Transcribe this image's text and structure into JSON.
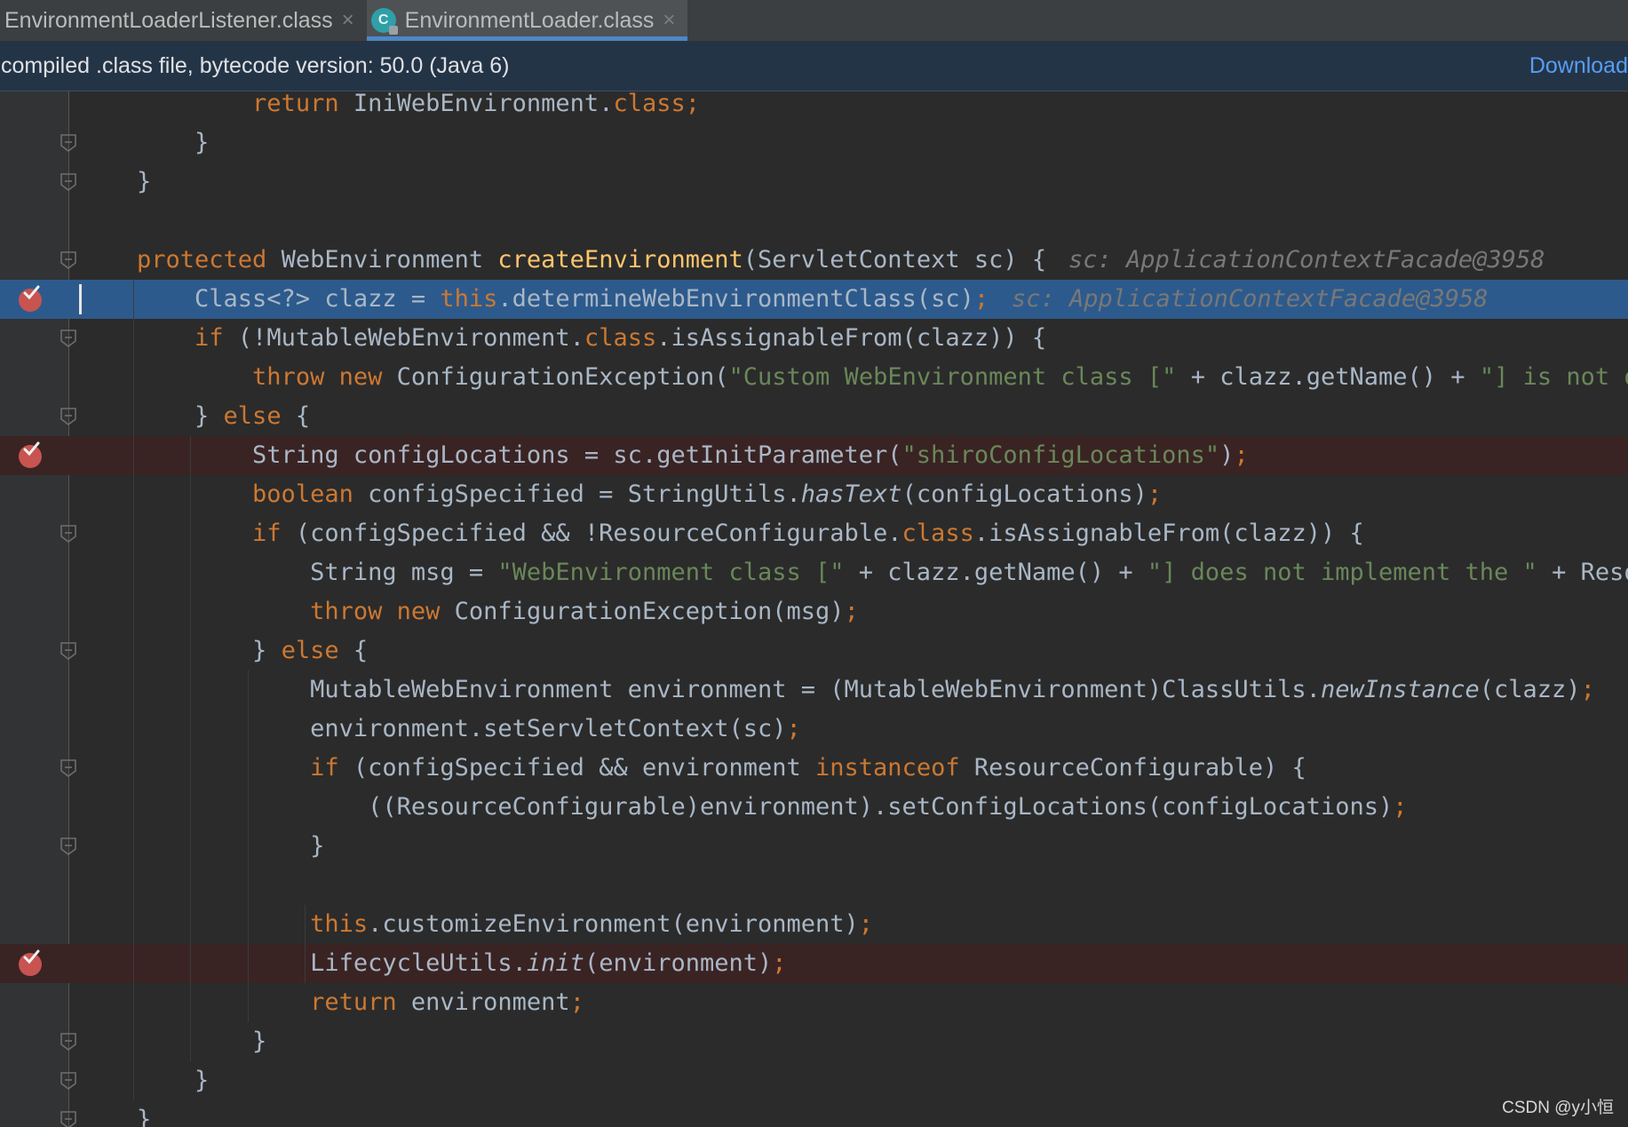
{
  "tabs": [
    {
      "label": "EnvironmentLoaderListener.class",
      "active": false
    },
    {
      "label": "EnvironmentLoader.class",
      "active": true
    }
  ],
  "tab_close_glyph": "×",
  "class_icon_letter": "C",
  "banner": {
    "text": "compiled .class file, bytecode version: 50.0 (Java 6)",
    "link": "Download"
  },
  "inline_hints": {
    "line4": "sc: ApplicationContextFacade@3958",
    "line5": "sc: ApplicationContextFacade@3958"
  },
  "code_lines": [
    "        return IniWebEnvironment.class;",
    "    }",
    "}",
    "",
    "protected WebEnvironment createEnvironment(ServletContext sc) {",
    "    Class<?> clazz = this.determineWebEnvironmentClass(sc);",
    "    if (!MutableWebEnvironment.class.isAssignableFrom(clazz)) {",
    "        throw new ConfigurationException(\"Custom WebEnvironment class [\" + clazz.getName() + \"] is not of",
    "    } else {",
    "        String configLocations = sc.getInitParameter(\"shiroConfigLocations\");",
    "        boolean configSpecified = StringUtils.hasText(configLocations);",
    "        if (configSpecified && !ResourceConfigurable.class.isAssignableFrom(clazz)) {",
    "            String msg = \"WebEnvironment class [\" + clazz.getName() + \"] does not implement the \" + Resou",
    "            throw new ConfigurationException(msg);",
    "        } else {",
    "            MutableWebEnvironment environment = (MutableWebEnvironment)ClassUtils.newInstance(clazz);",
    "            environment.setServletContext(sc);",
    "            if (configSpecified && environment instanceof ResourceConfigurable) {",
    "                ((ResourceConfigurable)environment).setConfigLocations(configLocations);",
    "            }",
    "",
    "            this.customizeEnvironment(environment);",
    "            LifecycleUtils.init(environment);",
    "            return environment;",
    "        }",
    "    }",
    "}"
  ],
  "execution_line_index": 5,
  "breakpoint_line_indexes": [
    5,
    9,
    22
  ],
  "colors": {
    "editor_bg": "#2b2b2b",
    "keyword": "#cc7832",
    "method_decl": "#ffc66d",
    "string": "#6a8759",
    "default_text": "#a9b7c6",
    "execution_line": "#2d5a8c",
    "breakpoint_line": "#3a2323",
    "breakpoint": "#c75450",
    "link": "#589df6"
  },
  "icons": [
    "class-file-icon",
    "close-icon",
    "breakpoint-icon",
    "fold-marker-icon"
  ],
  "watermark": "CSDN @y小恒"
}
